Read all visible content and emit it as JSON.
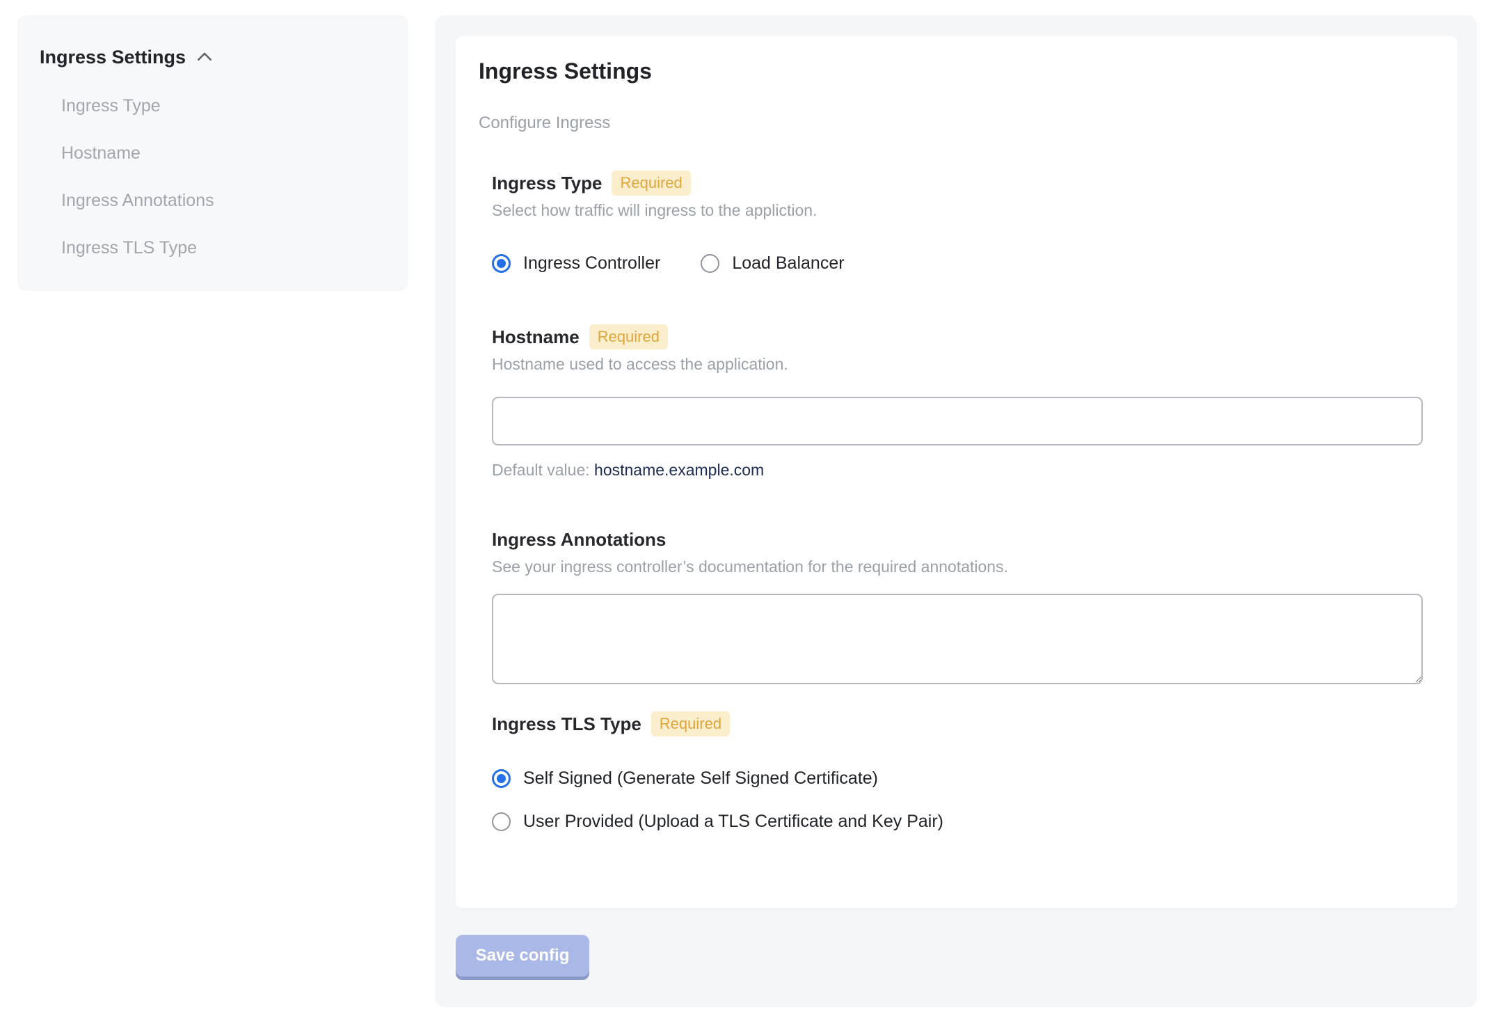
{
  "sidebar": {
    "title": "Ingress Settings",
    "items": [
      {
        "label": "Ingress Type"
      },
      {
        "label": "Hostname"
      },
      {
        "label": "Ingress Annotations"
      },
      {
        "label": "Ingress TLS Type"
      }
    ]
  },
  "main": {
    "title": "Ingress Settings",
    "subtitle": "Configure Ingress",
    "sections": {
      "ingress_type": {
        "label": "Ingress Type",
        "required_badge": "Required",
        "description": "Select how traffic will ingress to the appliction.",
        "options": [
          {
            "label": "Ingress Controller",
            "selected": true
          },
          {
            "label": "Load Balancer",
            "selected": false
          }
        ]
      },
      "hostname": {
        "label": "Hostname",
        "required_badge": "Required",
        "description": "Hostname used to access the application.",
        "value": "",
        "default_value_label": "Default value:",
        "default_value": "hostname.example.com"
      },
      "ingress_annotations": {
        "label": "Ingress Annotations",
        "description": "See your ingress controller’s documentation for the required annotations.",
        "value": ""
      },
      "ingress_tls_type": {
        "label": "Ingress TLS Type",
        "required_badge": "Required",
        "options": [
          {
            "label": "Self Signed (Generate Self Signed Certificate)",
            "selected": true
          },
          {
            "label": "User Provided (Upload a TLS Certificate and Key Pair)",
            "selected": false
          }
        ]
      }
    },
    "save_button_label": "Save config"
  },
  "colors": {
    "accent_blue": "#2570e8",
    "badge_bg": "#faeecd",
    "badge_text": "#dfa63c",
    "panel_bg": "#f5f6f8",
    "sidebar_bg": "#f7f8f9",
    "save_button_bg": "#aab8e8",
    "save_button_shadow": "#8a99c9",
    "default_value_text": "#1c2b50",
    "muted_text": "#9aa0a7"
  }
}
